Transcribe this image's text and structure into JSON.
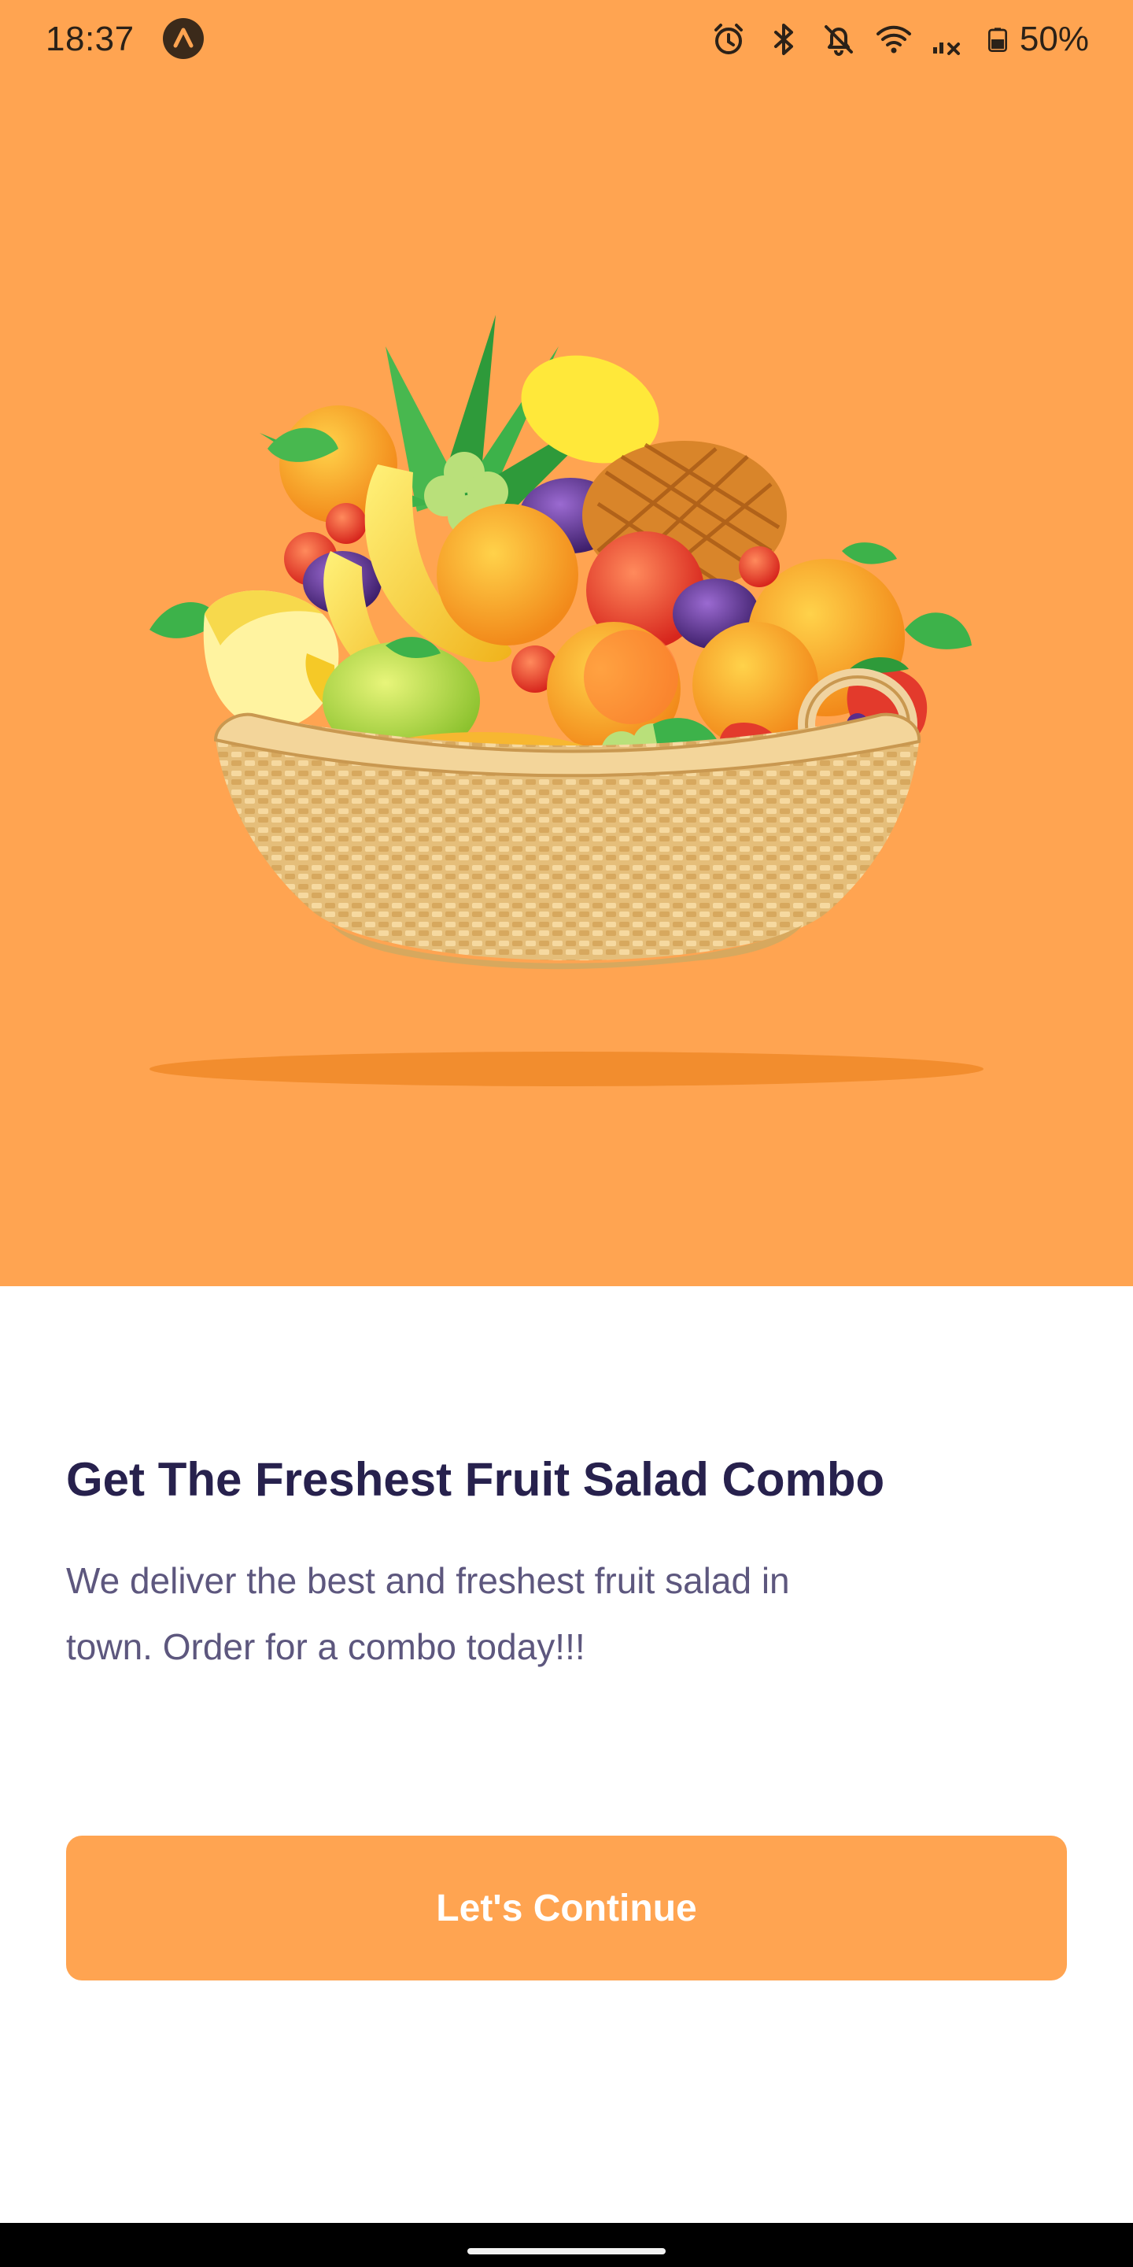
{
  "status_bar": {
    "time": "18:37",
    "battery": "50%",
    "icons": [
      "app-indicator-icon",
      "alarm-icon",
      "bluetooth-icon",
      "notifications-off-icon",
      "wifi-icon",
      "signal-icon",
      "battery-icon"
    ]
  },
  "hero": {
    "background_color": "#FFA451",
    "image": "fruit-basket-illustration"
  },
  "content": {
    "title": "Get The Freshest Fruit Salad Combo",
    "description_line1": "We deliver the best and freshest fruit salad in",
    "description_line2": "town. Order for a combo today!!!"
  },
  "cta": {
    "label": "Let's Continue",
    "color": "#FFA451"
  }
}
